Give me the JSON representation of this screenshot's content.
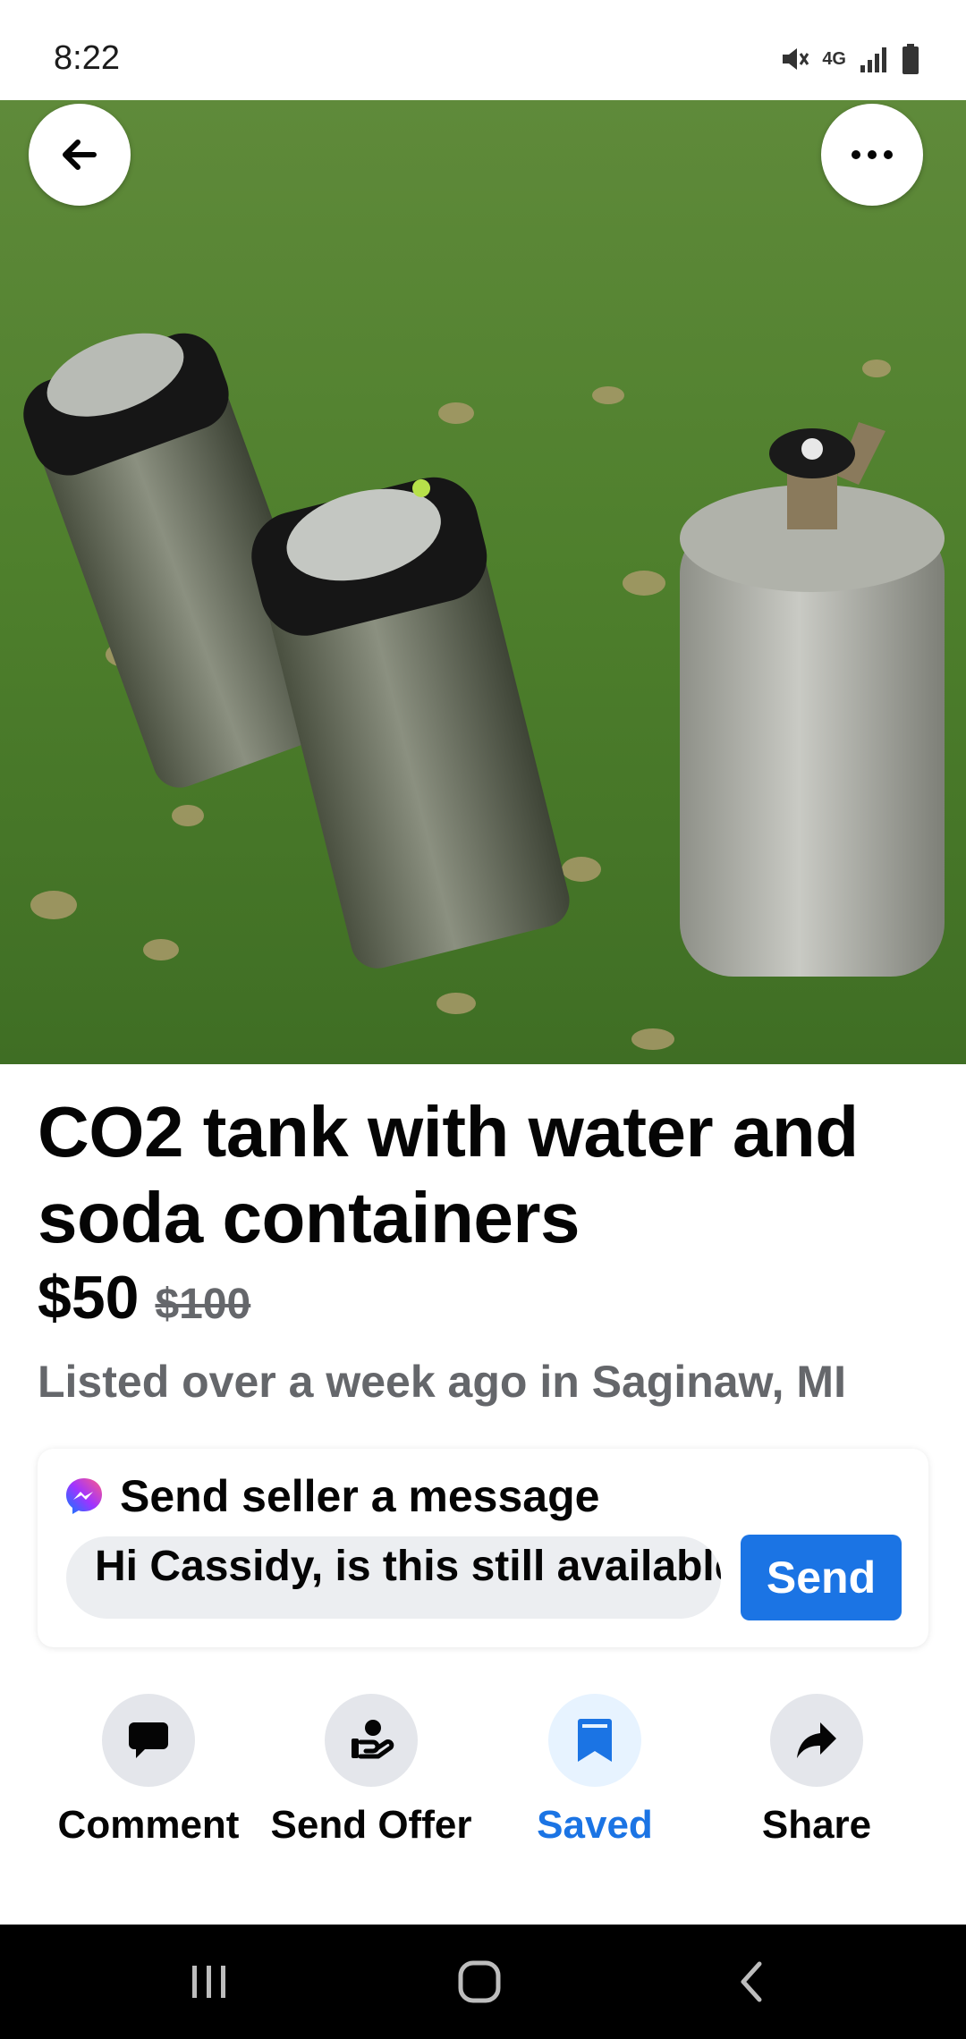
{
  "status_bar": {
    "time": "8:22",
    "network": "4G",
    "icons": [
      "mute-icon",
      "network-4g-icon",
      "signal-icon",
      "battery-icon"
    ]
  },
  "photo": {
    "alt_subject": "two soda kegs and a CO2 cylinder on grass"
  },
  "listing": {
    "title": "CO2 tank with water and soda containers",
    "price": "$50",
    "original_price": "$100",
    "listed": "Listed over a week ago in Saginaw, MI"
  },
  "message": {
    "title": "Send seller a message",
    "input_value": "Hi Cassidy, is this still available?",
    "send_label": "Send"
  },
  "actions": [
    {
      "label": "Comment",
      "icon": "comment-icon"
    },
    {
      "label": "Send Offer",
      "icon": "offer-icon"
    },
    {
      "label": "Saved",
      "icon": "bookmark-icon",
      "active": true
    },
    {
      "label": "Share",
      "icon": "share-icon"
    }
  ],
  "colors": {
    "accent": "#1b74e4",
    "secondary_text": "#65676b",
    "chip_bg": "#e4e6eb",
    "saved_bg": "#e7f3ff"
  }
}
